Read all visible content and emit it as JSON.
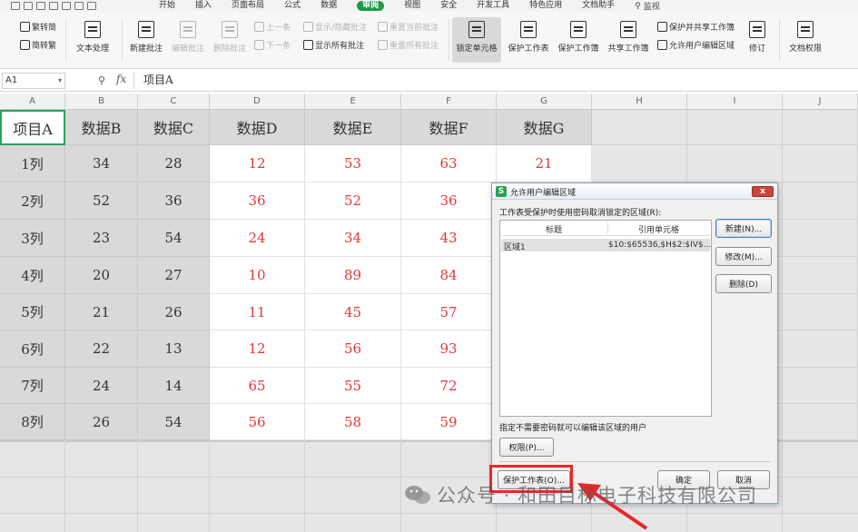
{
  "menubar": {
    "tabs": [
      "开始",
      "插入",
      "页面布局",
      "公式",
      "数据",
      "审阅",
      "视图",
      "安全",
      "开发工具",
      "特色应用",
      "文档助手"
    ],
    "active_tab": "审阅",
    "search_label": "监视"
  },
  "ribbon": {
    "trad_to_simp": "繁转简",
    "simp_to_trad": "简转繁",
    "text_process": "文本处理",
    "new_comment": "新建批注",
    "edit_comment": "编辑批注",
    "delete_comment": "删除批注",
    "prev": "上一条",
    "next": "下一条",
    "show_hide_comment": "显示/隐藏批注",
    "show_all_comments": "显示所有批注",
    "reset_current_comment": "重置当前批注",
    "reset_all_comments": "重置所有批注",
    "lock_cell": "锁定单元格",
    "protect_sheet": "保护工作表",
    "protect_workbook": "保护工作簿",
    "share_workbook": "共享工作簿",
    "protect_and_share": "保护并共享工作簿",
    "allow_edit_ranges": "允许用户编辑区域",
    "revisions": "修订",
    "doc_permissions": "文档权限"
  },
  "formula_bar": {
    "name_box": "A1",
    "fx": "fx",
    "content": "项目A"
  },
  "grid": {
    "columns": [
      "A",
      "B",
      "C",
      "D",
      "E",
      "F",
      "G",
      "H",
      "I",
      "J"
    ],
    "header_row": [
      "项目A",
      "数据B",
      "数据C",
      "数据D",
      "数据E",
      "数据F",
      "数据G"
    ],
    "rows": [
      [
        "1列",
        "34",
        "28",
        "12",
        "53",
        "63",
        "21"
      ],
      [
        "2列",
        "52",
        "36",
        "36",
        "52",
        "36",
        ""
      ],
      [
        "3列",
        "23",
        "54",
        "24",
        "34",
        "43",
        ""
      ],
      [
        "4列",
        "20",
        "27",
        "10",
        "89",
        "84",
        ""
      ],
      [
        "5列",
        "21",
        "26",
        "11",
        "45",
        "57",
        ""
      ],
      [
        "6列",
        "22",
        "13",
        "12",
        "56",
        "93",
        ""
      ],
      [
        "7列",
        "24",
        "14",
        "65",
        "55",
        "72",
        ""
      ],
      [
        "8列",
        "26",
        "54",
        "56",
        "58",
        "59",
        ""
      ]
    ]
  },
  "dialog": {
    "title": "允许用户编辑区域",
    "close": "x",
    "description": "工作表受保护时使用密码取消锁定的区域(R):",
    "col_title": "标题",
    "col_ref": "引用单元格",
    "range_name": "区域1",
    "range_ref": "$10:$65536,$H$2:$IV$...",
    "btn_new": "新建(N)...",
    "btn_modify": "修改(M)...",
    "btn_delete": "删除(D)",
    "users_text": "指定不需要密码就可以编辑该区域的用户",
    "btn_permissions": "权限(P)...",
    "btn_protect": "保护工作表(O)...",
    "btn_ok": "确定",
    "btn_cancel": "取消"
  },
  "watermark": {
    "text": "公众号 · 和田目标电子科技有限公司"
  },
  "colors": {
    "active_tab": "#1c9b49",
    "red_values": "#e23838",
    "highlight": "#e8272b"
  }
}
